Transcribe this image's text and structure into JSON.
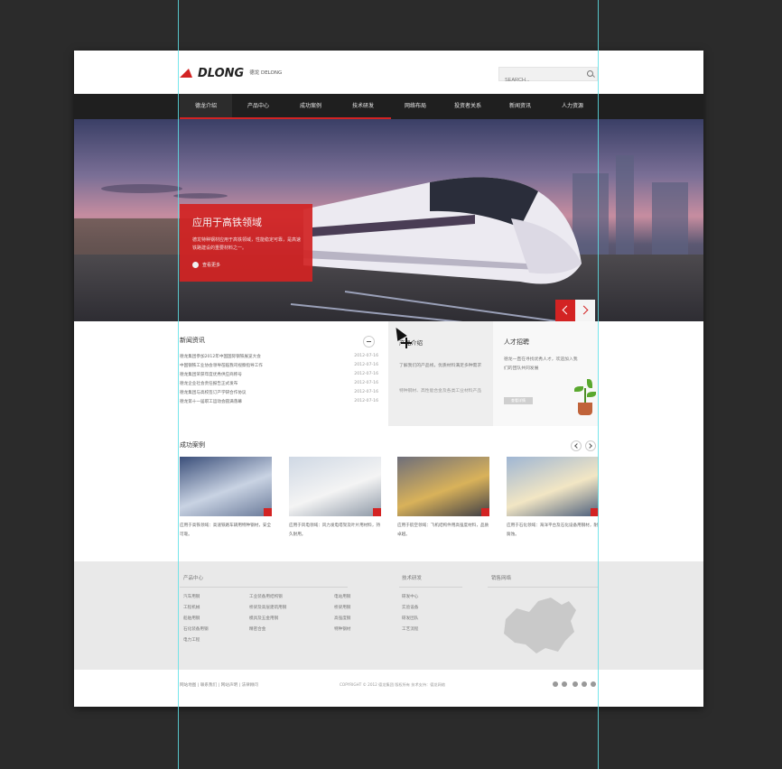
{
  "guides": {
    "color": "#5fe0e6"
  },
  "header": {
    "logo_text": "DLONG",
    "logo_sub": "德龙 DELONG",
    "search_placeholder": "SEARCH..."
  },
  "nav": {
    "items": [
      "德龙介绍",
      "产品中心",
      "成功案例",
      "技术研发",
      "网络布局",
      "投资者关系",
      "新闻资讯",
      "人力资源"
    ]
  },
  "banner": {
    "title": "应用于高铁领域",
    "text": "德龙特种钢材应用于高铁领域，性能稳定可靠，是高速铁路建设的重要材料之一。",
    "more": "查看更多"
  },
  "news": {
    "title": "新闻资讯",
    "items": [
      {
        "title": "德龙集团参加2012年中国国际钢铁展览大会",
        "date": "2012-07-16"
      },
      {
        "title": "中国钢铁工业协会领导莅临我司视察指导工作",
        "date": "2012-07-16"
      },
      {
        "title": "德龙集团荣获年度优秀供应商称号",
        "date": "2012-07-16"
      },
      {
        "title": "德龙企业社会责任报告正式发布",
        "date": "2012-07-16"
      },
      {
        "title": "德龙集团与高校签订产学研合作协议",
        "date": "2012-07-16"
      },
      {
        "title": "德龙第十一届职工运动会圆满落幕",
        "date": "2012-07-16"
      }
    ]
  },
  "product_box": {
    "title": "产品介绍",
    "text1": "了解我们的产品线，优质材料满足多种需求",
    "text2": "特种钢材、高性能合金及各类工业材料产品"
  },
  "talent": {
    "title": "人才招聘",
    "text": "德龙一直在寻找优秀人才，欢迎加入我们的团队共同发展",
    "button": "查看详情"
  },
  "cases": {
    "title": "成功案例",
    "items": [
      {
        "text": "应用于高铁领域：高速铁路车辆用特种钢材，安全可靠。",
        "colors": [
          "#3b4f7a",
          "#c9d3e3",
          "#6a7a99"
        ]
      },
      {
        "text": "应用于风电领域：风力发电塔架及叶片用材料，持久耐用。",
        "colors": [
          "#cfd8e4",
          "#f4f4f4",
          "#8d98a6"
        ]
      },
      {
        "text": "应用于航空领域：飞机结构件用高强度材料，品质卓越。",
        "colors": [
          "#6e6e7a",
          "#d9b25a",
          "#3d3d46"
        ]
      },
      {
        "text": "应用于石化领域：海洋平台及石化设备用钢材，耐腐蚀。",
        "colors": [
          "#9fb6d4",
          "#f2e6c4",
          "#4b5e7c"
        ]
      }
    ]
  },
  "footer": {
    "col1_title": "产品中心",
    "col1_items": [
      "汽车用钢",
      "工程机械",
      "船舶用钢",
      "石化装备用钢",
      "电力工程"
    ],
    "col2_items": [
      "工业装备用结构钢",
      "桥梁及高层建筑用钢",
      "模具及五金用钢",
      "精密合金"
    ],
    "col3_items": [
      "电站用钢",
      "桥梁用钢",
      "高强度钢",
      "特种钢材"
    ],
    "col4_title": "技术研发",
    "col4_items": [
      "研发中心",
      "实验设备",
      "研发团队",
      "工艺流程"
    ],
    "col5_title": "销售网络"
  },
  "bottom": {
    "left": "网站地图 | 联系我们 | 网站声明 | 法律顾问",
    "right": "COPYRIGHT © 2012 德龙集团 版权所有 技术支持：德龙网络"
  }
}
